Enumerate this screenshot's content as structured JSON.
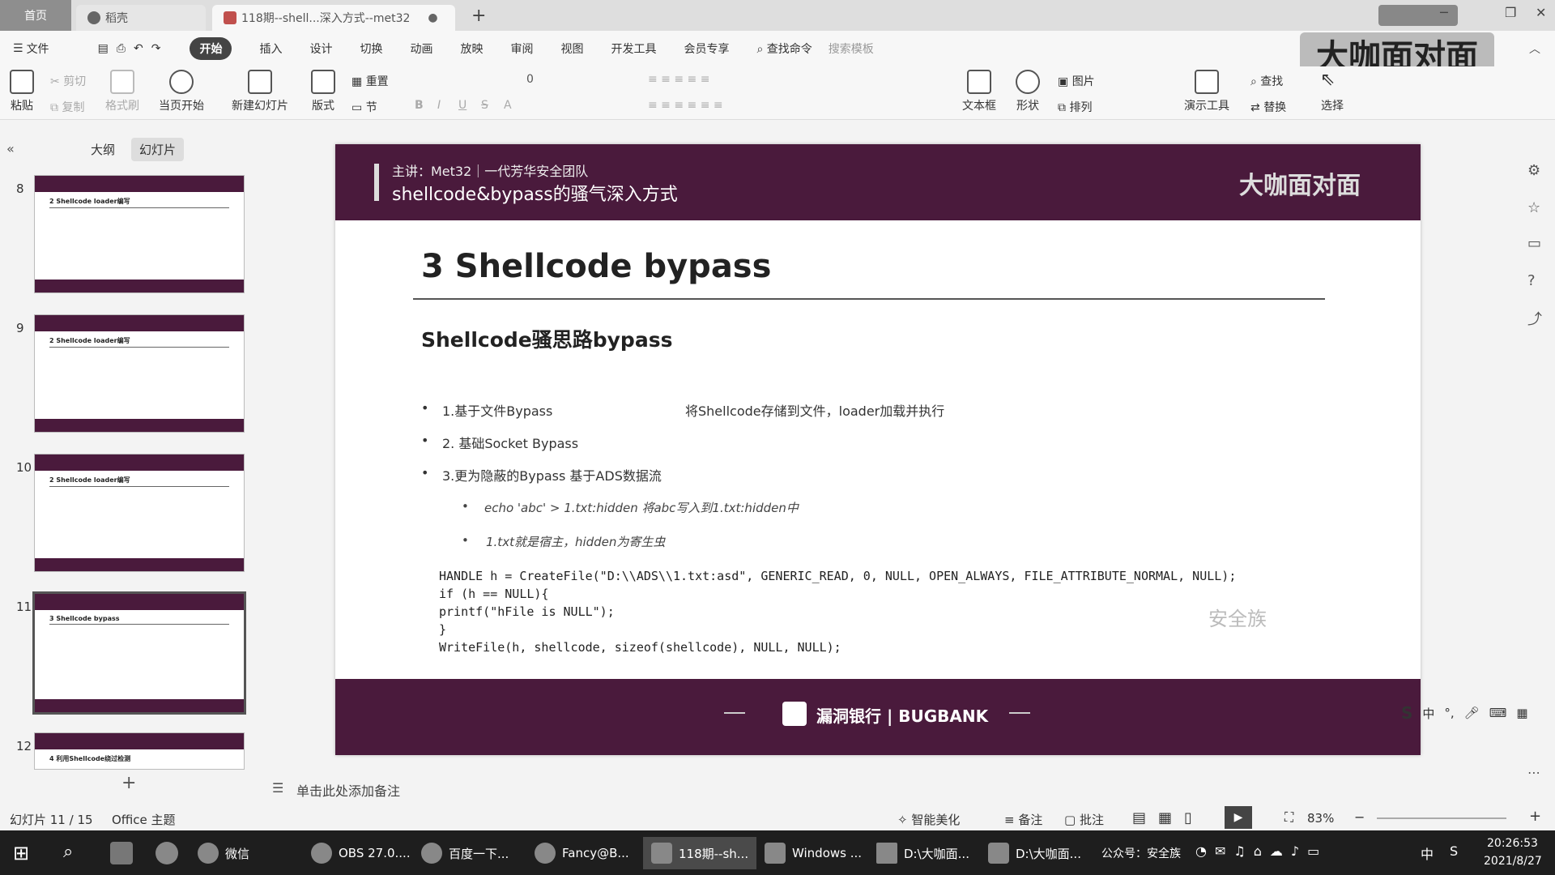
{
  "tabs": {
    "home": "首页",
    "doc": "稻壳",
    "active": "118期--shell...深入方式--met32"
  },
  "menu": [
    "文件",
    "开始",
    "插入",
    "设计",
    "切换",
    "动画",
    "放映",
    "审阅",
    "视图",
    "开发工具",
    "会员专享",
    "查找命令",
    "搜索模板"
  ],
  "ribbon": {
    "paste": "粘贴",
    "cut": "剪切",
    "copy": "复制",
    "format_painter": "格式刷",
    "from_current": "当页开始",
    "new_slide": "新建幻灯片",
    "layout": "版式",
    "section": "节",
    "reset": "重置",
    "font_size": "0",
    "textbox": "文本框",
    "shape": "形状",
    "picture": "图片",
    "arrange": "排列",
    "present_tool": "演示工具",
    "find": "查找",
    "replace": "替换",
    "select": "选择"
  },
  "watermark": "大咖面对面",
  "left_pane": {
    "tab_outline": "大纲",
    "tab_slides": "幻灯片",
    "thumbs": [
      {
        "num": "8",
        "title": "2 Shellcode loader编写"
      },
      {
        "num": "9",
        "title": "2 Shellcode loader编写"
      },
      {
        "num": "10",
        "title": "2 Shellcode loader编写"
      },
      {
        "num": "11",
        "title": "3 Shellcode bypass"
      },
      {
        "num": "12",
        "title": "4 利用Shellcode绕过检测"
      }
    ]
  },
  "slide": {
    "header_presenter": "主讲：Met32｜一代芳华安全团队",
    "header_title": "shellcode&bypass的骚气深入方式",
    "header_badge": "大咖面对面",
    "title": "3 Shellcode bypass",
    "subtitle": "Shellcode骚思路bypass",
    "bullets": [
      {
        "text": "1.基于文件Bypass",
        "note": "将Shellcode存储到文件，loader加载并执行"
      },
      {
        "text": "2. 基础Socket Bypass",
        "note": ""
      },
      {
        "text": "3.更为隐蔽的Bypass 基于ADS数据流",
        "note": ""
      }
    ],
    "sub_bullets": [
      "echo 'abc' > 1.txt:hidden  将abc写入到1.txt:hidden中",
      "1.txt就是宿主，hidden为寄生虫"
    ],
    "code": [
      "HANDLE h = CreateFile(\"D:\\\\ADS\\\\1.txt:asd\", GENERIC_READ, 0, NULL, OPEN_ALWAYS, FILE_ATTRIBUTE_NORMAL, NULL);",
      "if (h == NULL){",
      "printf(\"hFile is NULL\");",
      "}",
      "WriteFile(h, shellcode, sizeof(shellcode), NULL, NULL);"
    ],
    "watermark": "安全族",
    "footer_brand": "漏洞银行 | BUGBANK"
  },
  "notes_placeholder": "单击此处添加备注",
  "status": {
    "slide_pos": "幻灯片 11 / 15",
    "theme": "Office 主题",
    "beautify": "智能美化",
    "notes": "备注",
    "comment": "批注",
    "zoom": "83%"
  },
  "ime": "中",
  "taskbar": {
    "items": [
      "微信",
      "OBS 27.0....",
      "百度一下...",
      "Fancy@B...",
      "118期--sh...",
      "Windows ...",
      "D:\\大咖面...",
      "D:\\大咖面..."
    ],
    "public_account": "公众号：安全族",
    "ime": "中",
    "time": "20:26:53",
    "date": "2021/8/27"
  }
}
